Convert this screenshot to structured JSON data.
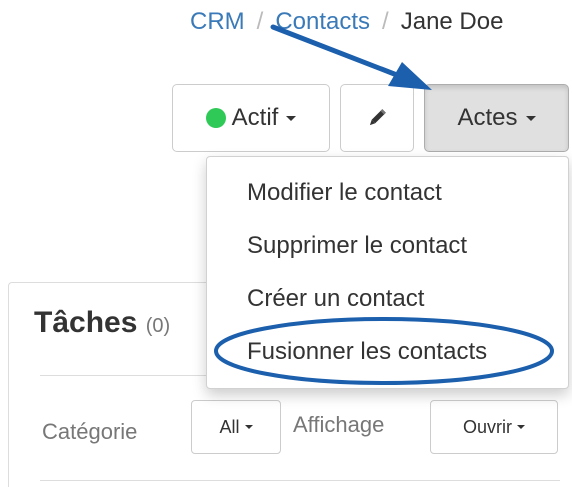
{
  "breadcrumb": {
    "items": [
      "CRM",
      "Contacts"
    ],
    "separator": "/",
    "current": "Jane Doe"
  },
  "toolbar": {
    "status_label": "Actif",
    "status_color": "#2ec957",
    "edit_icon": "pencil-icon",
    "actions_label": "Actes"
  },
  "actions_menu": {
    "items": [
      "Modifier le contact",
      "Supprimer le contact",
      "Créer un contact",
      "Fusionner les contacts"
    ],
    "highlighted_item": "Fusionner les contacts"
  },
  "annotation": {
    "color": "#1b5fad"
  },
  "tasks": {
    "title": "Tâches",
    "count": "(0)",
    "category_label": "Catégorie",
    "category_value": "All",
    "display_label": "Affichage",
    "display_value": "Ouvrir"
  }
}
